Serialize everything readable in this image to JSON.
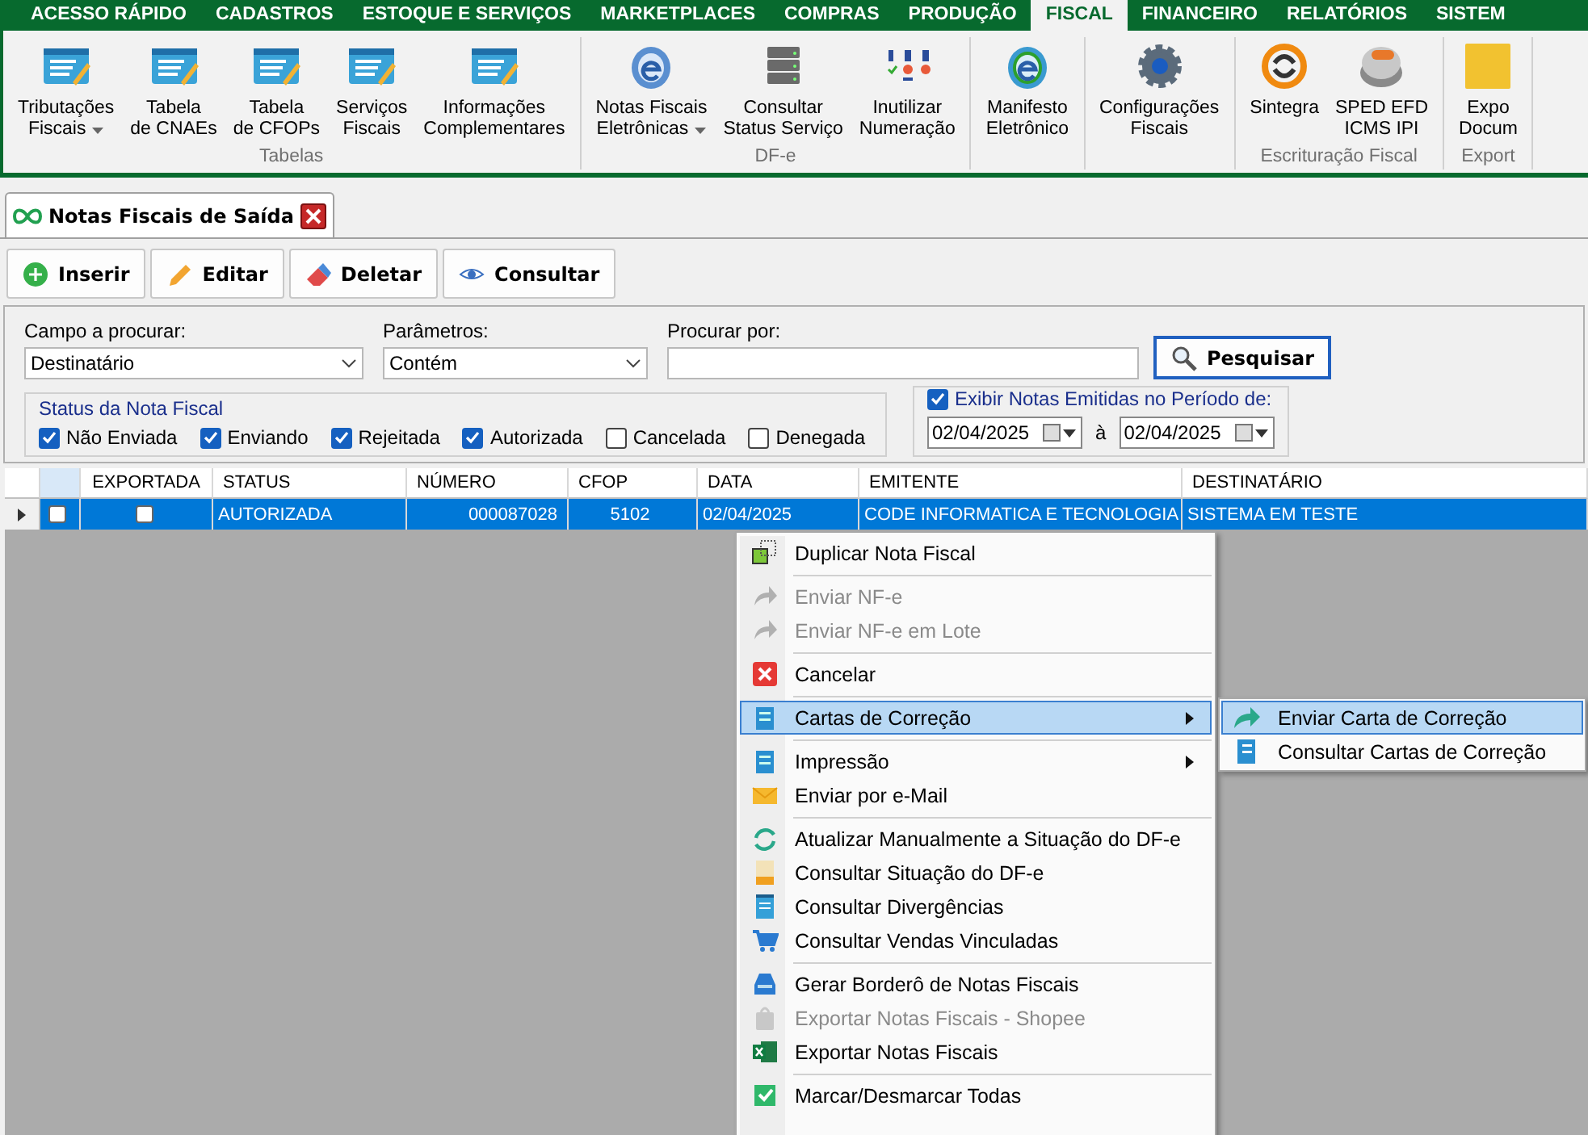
{
  "menu_tabs": [
    {
      "label": "ACESSO RÁPIDO",
      "selected": false
    },
    {
      "label": "CADASTROS",
      "selected": false
    },
    {
      "label": "ESTOQUE E SERVIÇOS",
      "selected": false
    },
    {
      "label": "MARKETPLACES",
      "selected": false
    },
    {
      "label": "COMPRAS",
      "selected": false
    },
    {
      "label": "PRODUÇÃO",
      "selected": false
    },
    {
      "label": "FISCAL",
      "selected": true
    },
    {
      "label": "FINANCEIRO",
      "selected": false
    },
    {
      "label": "RELATÓRIOS",
      "selected": false
    },
    {
      "label": "SISTEM",
      "selected": false
    }
  ],
  "ribbon": {
    "groups": [
      {
        "label": "Tabelas",
        "items": [
          {
            "lines": [
              "Tributações",
              "Fiscais"
            ],
            "dropdown": true
          },
          {
            "lines": [
              "Tabela",
              "de CNAEs"
            ],
            "dropdown": false
          },
          {
            "lines": [
              "Tabela",
              "de CFOPs"
            ],
            "dropdown": false
          },
          {
            "lines": [
              "Serviços",
              "Fiscais"
            ],
            "dropdown": false
          },
          {
            "lines": [
              "Informações",
              "Complementares"
            ],
            "dropdown": false
          }
        ]
      },
      {
        "label": "DF-e",
        "items": [
          {
            "lines": [
              "Notas Fiscais",
              "Eletrônicas"
            ],
            "dropdown": true
          },
          {
            "lines": [
              "Consultar",
              "Status Serviço"
            ],
            "dropdown": false
          },
          {
            "lines": [
              "Inutilizar",
              "Numeração"
            ],
            "dropdown": false
          }
        ]
      },
      {
        "items": [
          {
            "lines": [
              "Manifesto",
              "Eletrônico"
            ],
            "dropdown": false
          }
        ]
      },
      {
        "items": [
          {
            "lines": [
              "Configurações",
              "Fiscais"
            ],
            "dropdown": false
          }
        ]
      },
      {
        "label": "Escrituração Fiscal",
        "items": [
          {
            "lines": [
              "Sintegra"
            ],
            "dropdown": false
          },
          {
            "lines": [
              "SPED EFD",
              "ICMS IPI"
            ],
            "dropdown": false
          }
        ]
      },
      {
        "label": "Export",
        "items": [
          {
            "lines": [
              "Expo",
              "Docum"
            ],
            "dropdown": false
          }
        ]
      }
    ]
  },
  "document_tab": {
    "title": "Notas Fiscais de Saída"
  },
  "toolbar": [
    "Inserir",
    "Editar",
    "Deletar",
    "Consultar"
  ],
  "filters": {
    "field": {
      "label": "Campo a procurar:",
      "value": "Destinatário"
    },
    "parameters": {
      "label": "Parâmetros:",
      "value": "Contém"
    },
    "search": {
      "label": "Procurar por:"
    },
    "search_button": "Pesquisar",
    "status": {
      "title": "Status da Nota Fiscal",
      "options": [
        {
          "label": "Não Enviada",
          "checked": true
        },
        {
          "label": "Enviando",
          "checked": true
        },
        {
          "label": "Rejeitada",
          "checked": true
        },
        {
          "label": "Autorizada",
          "checked": true
        },
        {
          "label": "Cancelada",
          "checked": false
        },
        {
          "label": "Denegada",
          "checked": false
        }
      ]
    },
    "period": {
      "label": "Exibir Notas Emitidas no Período de:",
      "checked": true,
      "from": "02/04/2025",
      "between": "à",
      "to": "02/04/2025"
    }
  },
  "grid": {
    "exported_column": "EXPORTADA",
    "columns": [
      "STATUS",
      "NÚMERO",
      "CFOP",
      "DATA",
      "EMITENTE",
      "DESTINATÁRIO"
    ],
    "rows": [
      {
        "selected": true,
        "checked": false,
        "exported": false,
        "cells": [
          "AUTORIZADA",
          "000087028",
          "5102",
          "02/04/2025",
          "CODE INFORMATICA E TECNOLOGIA",
          "SISTEMA EM TESTE"
        ]
      }
    ]
  },
  "context_menu": {
    "items": [
      {
        "kind": "item",
        "label": "Duplicar Nota Fiscal",
        "disabled": false,
        "submenu": false,
        "selected": false
      },
      {
        "kind": "separator"
      },
      {
        "kind": "item",
        "label": "Enviar NF-e",
        "disabled": true,
        "submenu": false,
        "selected": false
      },
      {
        "kind": "item",
        "label": "Enviar NF-e em Lote",
        "disabled": true,
        "submenu": false,
        "selected": false
      },
      {
        "kind": "separator"
      },
      {
        "kind": "item",
        "label": "Cancelar",
        "disabled": false,
        "submenu": false,
        "selected": false
      },
      {
        "kind": "separator"
      },
      {
        "kind": "item",
        "label": "Cartas de Correção",
        "disabled": false,
        "submenu": true,
        "selected": true
      },
      {
        "kind": "separator"
      },
      {
        "kind": "item",
        "label": "Impressão",
        "disabled": false,
        "submenu": true,
        "selected": false
      },
      {
        "kind": "item",
        "label": "Enviar por e-Mail",
        "disabled": false,
        "submenu": false,
        "selected": false
      },
      {
        "kind": "separator"
      },
      {
        "kind": "item",
        "label": "Atualizar Manualmente a Situação do DF-e",
        "disabled": false,
        "submenu": false,
        "selected": false
      },
      {
        "kind": "item",
        "label": "Consultar Situação do DF-e",
        "disabled": false,
        "submenu": false,
        "selected": false
      },
      {
        "kind": "item",
        "label": "Consultar Divergências",
        "disabled": false,
        "submenu": false,
        "selected": false
      },
      {
        "kind": "item",
        "label": "Consultar Vendas Vinculadas",
        "disabled": false,
        "submenu": false,
        "selected": false
      },
      {
        "kind": "separator"
      },
      {
        "kind": "item",
        "label": "Gerar Borderô de Notas Fiscais",
        "disabled": false,
        "submenu": false,
        "selected": false
      },
      {
        "kind": "item",
        "label": "Exportar Notas Fiscais - Shopee",
        "disabled": true,
        "submenu": false,
        "selected": false
      },
      {
        "kind": "item",
        "label": "Exportar Notas Fiscais",
        "disabled": false,
        "submenu": false,
        "selected": false
      },
      {
        "kind": "separator"
      },
      {
        "kind": "item",
        "label": "Marcar/Desmarcar Todas",
        "disabled": false,
        "submenu": false,
        "selected": false
      }
    ]
  },
  "submenu": {
    "items": [
      {
        "label": "Enviar Carta de Correção",
        "selected": true
      },
      {
        "label": "Consultar Cartas de Correção",
        "selected": false
      }
    ]
  }
}
